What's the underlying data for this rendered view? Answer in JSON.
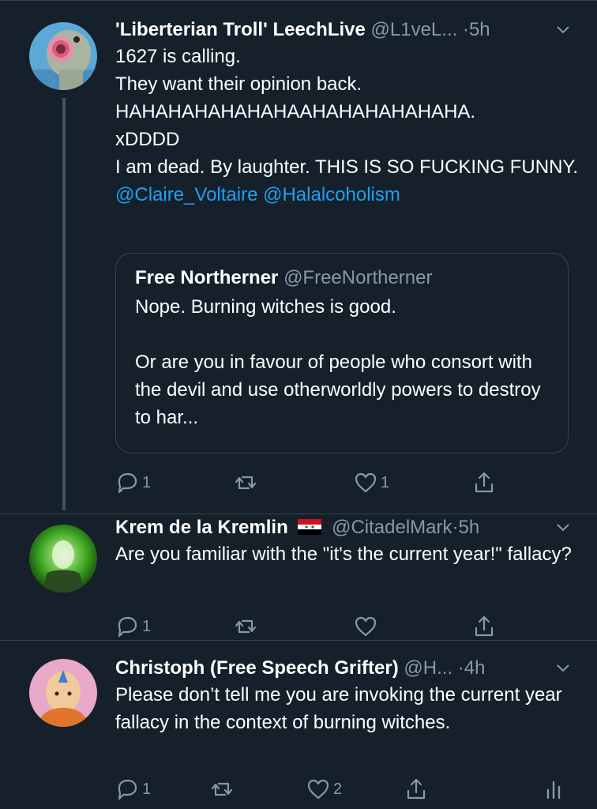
{
  "tweets": [
    {
      "display_name": "'Liberterian Troll' LeechLive",
      "handle": "@L1veL...",
      "time": "5h",
      "lines": [
        "1627 is calling.",
        "They want their opinion back.",
        "HAHAHAHAHAHAHAAHAHAHAHAHAHA.",
        "xDDDD",
        "I am dead. By laughter. THIS IS SO FUCKING FUNNY."
      ],
      "mentions": "@Claire_Voltaire @Halalcoholism",
      "quote": {
        "display_name": "Free Northerner",
        "handle": "@FreeNortherner",
        "line1": "Nope. Burning witches is good.",
        "line2": "Or are you in favour of people who consort with the devil and use otherworldly powers to destroy to har..."
      },
      "reply_count": "1",
      "retweet_count": "",
      "like_count": "1"
    },
    {
      "display_name": "Krem de la Kremlin",
      "handle": "@CitadelMark",
      "time": "5h",
      "text": "Are you familiar with the \"it's the current year!\" fallacy?",
      "reply_count": "1",
      "retweet_count": "",
      "like_count": ""
    },
    {
      "display_name": "Christoph (Free Speech Grifter)",
      "handle": "@H...",
      "time": "4h",
      "text": "Please don’t tell me you are invoking the current year fallacy in the context of burning witches.",
      "reply_count": "1",
      "retweet_count": "",
      "like_count": "2"
    }
  ],
  "separator": "·",
  "icons": [
    "reply-icon",
    "retweet-icon",
    "like-icon",
    "share-icon",
    "analytics-icon",
    "chevron-down-icon",
    "syria-flag-icon"
  ],
  "colors": {
    "background": "#15202b",
    "text": "#ffffff",
    "secondary": "#8899a6",
    "link": "#1da1f2",
    "border": "#38444d"
  }
}
